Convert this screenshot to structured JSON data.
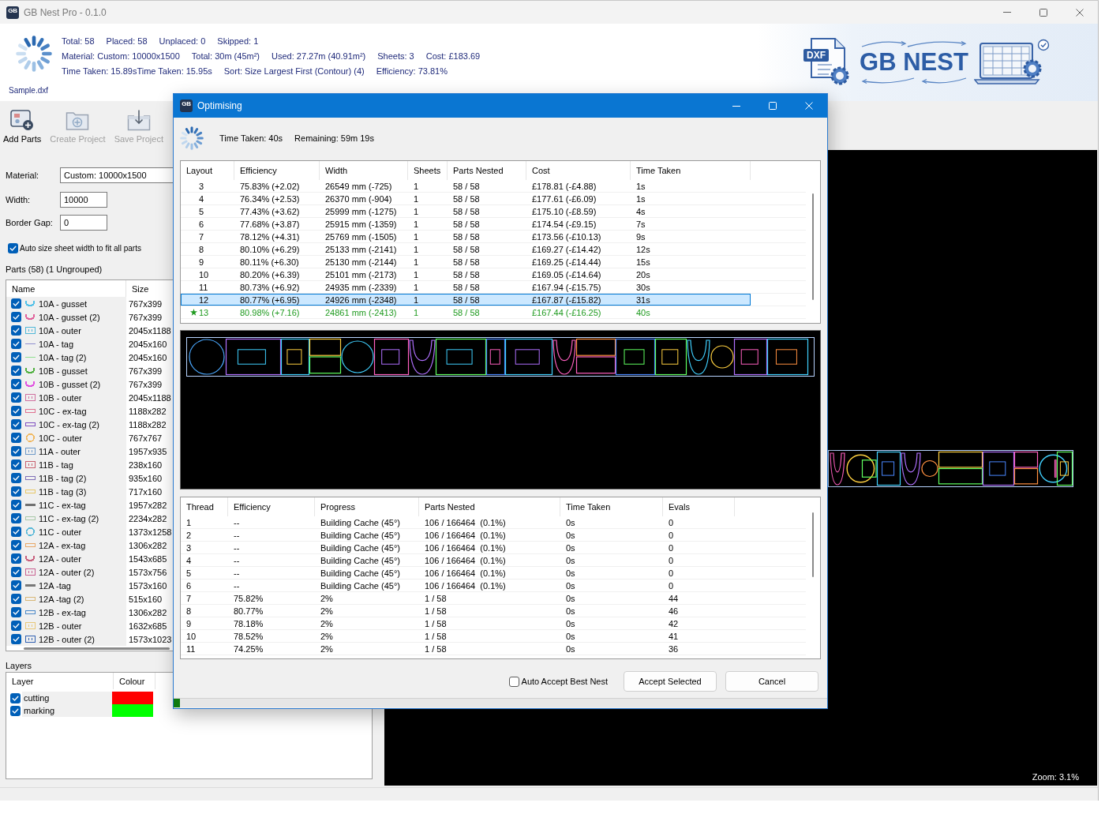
{
  "window": {
    "title": "GB Nest Pro - 0.1.0",
    "icon_text": "GB"
  },
  "summary": {
    "lines": [
      [
        "Total: 58",
        "Placed: 58",
        "Unplaced: 0",
        "Skipped: 1"
      ],
      [
        "Material: Custom: 10000x1500",
        "Total: 30m (45m²)",
        "Used: 27.27m (40.91m²)",
        "Sheets: 3",
        "Cost: £183.69"
      ],
      [
        "Time Taken: 15.89sTime Taken: 15.95s",
        "Sort: Size Largest First (Contour) (4)",
        "Efficiency: 73.81%"
      ]
    ],
    "file_name": "Sample.dxf"
  },
  "logo": {
    "badge": "DXF",
    "text": "GB NEST"
  },
  "toolbar": [
    {
      "label": "Add Parts",
      "kind": "add",
      "disabled": false
    },
    {
      "label": "Create Project",
      "kind": "new",
      "disabled": true
    },
    {
      "label": "Save Project",
      "kind": "save",
      "disabled": true
    }
  ],
  "settings": {
    "fields": [
      {
        "label": "Material:",
        "value": "Custom: 10000x1500",
        "kind": "combo"
      },
      {
        "label": "Width:",
        "value": "10000",
        "kind": "number"
      },
      {
        "label": "Border Gap:",
        "value": "0",
        "kind": "number"
      }
    ],
    "auto_size": {
      "label": "Auto size sheet width to fit all parts",
      "checked": true
    }
  },
  "parts": {
    "title": "Parts (58) (1 Ungrouped)",
    "columns": [
      "Name",
      "Size"
    ],
    "rows": [
      {
        "name": "10A - gusset",
        "size": "767x399",
        "checked": true,
        "kind": "cup",
        "color": "#50c0e8"
      },
      {
        "name": "10A - gusset (2)",
        "size": "767x399",
        "checked": true,
        "kind": "cup",
        "color": "#e0609a"
      },
      {
        "name": "10A - outer",
        "size": "2045x1188",
        "checked": true,
        "kind": "frame",
        "color": "#50b8d8"
      },
      {
        "name": "10A - tag",
        "size": "2045x160",
        "checked": true,
        "kind": "line",
        "color": "#9090d0"
      },
      {
        "name": "10A - tag (2)",
        "size": "2045x160",
        "checked": true,
        "kind": "line",
        "color": "#90e090"
      },
      {
        "name": "10B - gusset",
        "size": "767x399",
        "checked": true,
        "kind": "cup",
        "color": "#50b040"
      },
      {
        "name": "10B - gusset (2)",
        "size": "767x399",
        "checked": true,
        "kind": "cup",
        "color": "#e050e0"
      },
      {
        "name": "10B - outer",
        "size": "2045x1188",
        "checked": true,
        "kind": "frame",
        "color": "#d070a0"
      },
      {
        "name": "10C - ex-tag",
        "size": "1188x282",
        "checked": true,
        "kind": "slot",
        "color": "#e07090"
      },
      {
        "name": "10C - ex-tag (2)",
        "size": "1188x282",
        "checked": true,
        "kind": "slot",
        "color": "#8050c0"
      },
      {
        "name": "10C - outer",
        "size": "767x767",
        "checked": true,
        "kind": "ring",
        "color": "#f0b860"
      },
      {
        "name": "11A - outer",
        "size": "1957x935",
        "checked": true,
        "kind": "frame",
        "color": "#6c98c8"
      },
      {
        "name": "11B - tag",
        "size": "238x160",
        "checked": true,
        "kind": "frame",
        "color": "#c8606e"
      },
      {
        "name": "11B - tag (2)",
        "size": "935x160",
        "checked": true,
        "kind": "slot",
        "color": "#8070b8"
      },
      {
        "name": "11B - tag (3)",
        "size": "717x160",
        "checked": true,
        "kind": "slot",
        "color": "#e8c868"
      },
      {
        "name": "11C - ex-tag",
        "size": "1957x282",
        "checked": true,
        "kind": "bar",
        "color": "#707070"
      },
      {
        "name": "11C - ex-tag (2)",
        "size": "2234x282",
        "checked": true,
        "kind": "slot",
        "color": "#a8c8a8"
      },
      {
        "name": "11C - outer",
        "size": "1373x1258",
        "checked": true,
        "kind": "ring",
        "color": "#58b8d8"
      },
      {
        "name": "12A - ex-tag",
        "size": "1306x282",
        "checked": true,
        "kind": "slot",
        "color": "#e8a868"
      },
      {
        "name": "12A - outer",
        "size": "1543x685",
        "checked": true,
        "kind": "cup",
        "color": "#c8607e"
      },
      {
        "name": "12A - outer (2)",
        "size": "1573x756",
        "checked": true,
        "kind": "frame",
        "color": "#c86090"
      },
      {
        "name": "12A -tag",
        "size": "1573x160",
        "checked": true,
        "kind": "bar",
        "color": "#787878"
      },
      {
        "name": "12A -tag (2)",
        "size": "515x160",
        "checked": true,
        "kind": "slot",
        "color": "#d8b878"
      },
      {
        "name": "12B - ex-tag",
        "size": "1306x282",
        "checked": true,
        "kind": "slot",
        "color": "#4a88c8"
      },
      {
        "name": "12B - outer",
        "size": "1632x685",
        "checked": true,
        "kind": "frame",
        "color": "#e8c878"
      },
      {
        "name": "12B - outer (2)",
        "size": "1573x1023",
        "checked": true,
        "kind": "frame",
        "color": "#3060b0"
      }
    ]
  },
  "layers": {
    "title": "Layers",
    "columns": [
      "Layer",
      "Colour"
    ],
    "rows": [
      {
        "name": "cutting",
        "checked": true,
        "color": "#ff0000"
      },
      {
        "name": "marking",
        "checked": true,
        "color": "#00ff00"
      }
    ]
  },
  "canvas": {
    "zoom": "Zoom: 3.1%"
  },
  "dialog": {
    "title": "Optimising",
    "icon_text": "GB",
    "time_taken": "Time Taken: 40s",
    "remaining": "Remaining: 59m 19s",
    "layouts": {
      "columns": [
        "Layout",
        "Efficiency",
        "Width",
        "Sheets",
        "Parts Nested",
        "Cost",
        "Time Taken"
      ],
      "rows": [
        {
          "cells": [
            "3",
            "75.83% (+2.02)",
            "26549 mm (-725)",
            "1",
            "58 / 58",
            "£178.81 (-£4.88)",
            "1s"
          ],
          "selected": false,
          "best": false
        },
        {
          "cells": [
            "4",
            "76.34% (+2.53)",
            "26370 mm (-904)",
            "1",
            "58 / 58",
            "£177.61 (-£6.09)",
            "1s"
          ],
          "selected": false,
          "best": false
        },
        {
          "cells": [
            "5",
            "77.43% (+3.62)",
            "25999 mm (-1275)",
            "1",
            "58 / 58",
            "£175.10 (-£8.59)",
            "4s"
          ],
          "selected": false,
          "best": false
        },
        {
          "cells": [
            "6",
            "77.68% (+3.87)",
            "25915 mm (-1359)",
            "1",
            "58 / 58",
            "£174.54 (-£9.15)",
            "7s"
          ],
          "selected": false,
          "best": false
        },
        {
          "cells": [
            "7",
            "78.12% (+4.31)",
            "25769 mm (-1505)",
            "1",
            "58 / 58",
            "£173.56 (-£10.13)",
            "9s"
          ],
          "selected": false,
          "best": false
        },
        {
          "cells": [
            "8",
            "80.10% (+6.29)",
            "25133 mm (-2141)",
            "1",
            "58 / 58",
            "£169.27 (-£14.42)",
            "12s"
          ],
          "selected": false,
          "best": false
        },
        {
          "cells": [
            "9",
            "80.11% (+6.30)",
            "25130 mm (-2144)",
            "1",
            "58 / 58",
            "£169.25 (-£14.44)",
            "15s"
          ],
          "selected": false,
          "best": false
        },
        {
          "cells": [
            "10",
            "80.20% (+6.39)",
            "25101 mm (-2173)",
            "1",
            "58 / 58",
            "£169.05 (-£14.64)",
            "20s"
          ],
          "selected": false,
          "best": false
        },
        {
          "cells": [
            "11",
            "80.73% (+6.92)",
            "24935 mm (-2339)",
            "1",
            "58 / 58",
            "£167.94 (-£15.75)",
            "30s"
          ],
          "selected": false,
          "best": false
        },
        {
          "cells": [
            "12",
            "80.77% (+6.95)",
            "24926 mm (-2348)",
            "1",
            "58 / 58",
            "£167.87 (-£15.82)",
            "31s"
          ],
          "selected": true,
          "best": false
        },
        {
          "cells": [
            "13",
            "80.98% (+7.16)",
            "24861 mm (-2413)",
            "1",
            "58 / 58",
            "£167.44 (-£16.25)",
            "40s"
          ],
          "selected": false,
          "best": true
        }
      ]
    },
    "threads": {
      "columns": [
        "Thread",
        "Efficiency",
        "Progress",
        "Parts Nested",
        "Time Taken",
        "Evals"
      ],
      "rows": [
        [
          "1",
          "--",
          "Building Cache (45°)",
          "106 / 166464  (0.1%)",
          "0s",
          "0"
        ],
        [
          "2",
          "--",
          "Building Cache (45°)",
          "106 / 166464  (0.1%)",
          "0s",
          "0"
        ],
        [
          "3",
          "--",
          "Building Cache (45°)",
          "106 / 166464  (0.1%)",
          "0s",
          "0"
        ],
        [
          "4",
          "--",
          "Building Cache (45°)",
          "106 / 166464  (0.1%)",
          "0s",
          "0"
        ],
        [
          "5",
          "--",
          "Building Cache (45°)",
          "106 / 166464  (0.1%)",
          "0s",
          "0"
        ],
        [
          "6",
          "--",
          "Building Cache (45°)",
          "106 / 166464  (0.1%)",
          "0s",
          "0"
        ],
        [
          "7",
          "75.82%",
          "2%",
          "1 / 58",
          "0s",
          "44"
        ],
        [
          "8",
          "80.77%",
          "2%",
          "1 / 58",
          "0s",
          "46"
        ],
        [
          "9",
          "78.18%",
          "2%",
          "1 / 58",
          "0s",
          "42"
        ],
        [
          "10",
          "78.52%",
          "2%",
          "1 / 58",
          "0s",
          "41"
        ],
        [
          "11",
          "74.25%",
          "2%",
          "1 / 58",
          "0s",
          "36"
        ]
      ]
    },
    "auto_accept": {
      "label": "Auto Accept Best Nest",
      "checked": false
    },
    "buttons": [
      "Accept Selected",
      "Cancel"
    ],
    "progress": {
      "level": 0.01
    }
  }
}
